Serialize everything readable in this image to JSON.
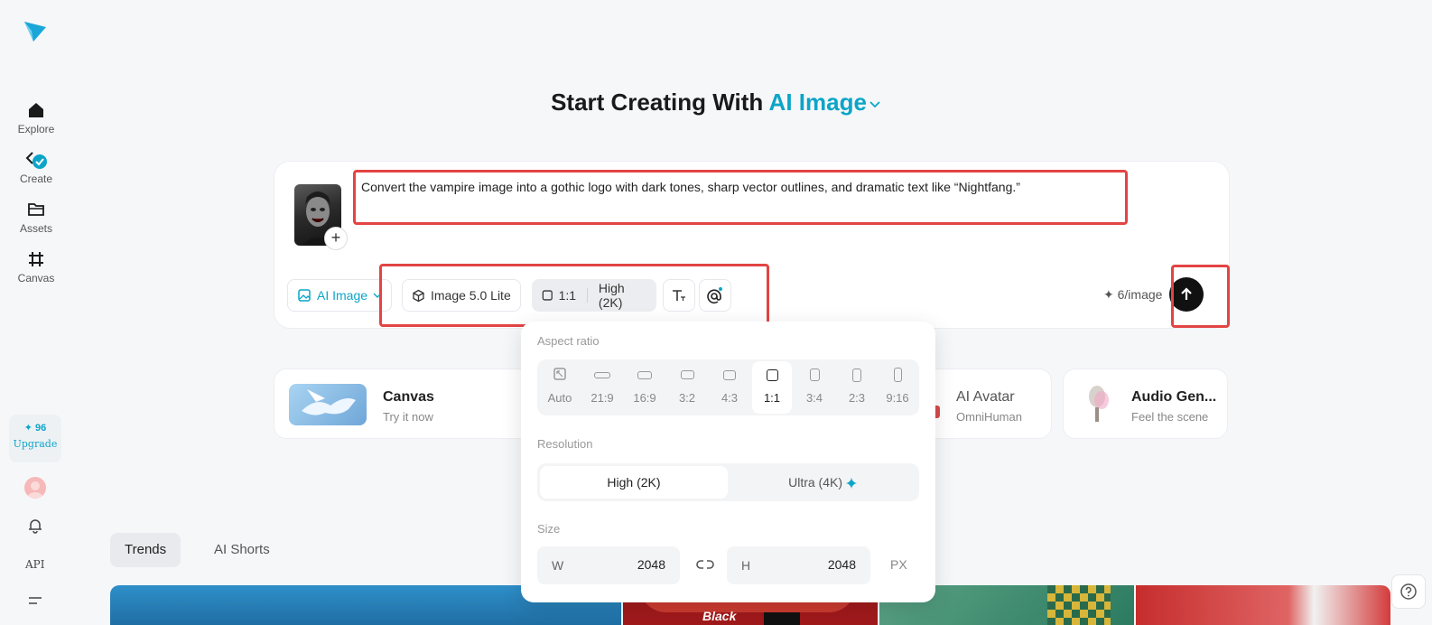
{
  "sidebar": {
    "items": [
      {
        "label": "Explore",
        "icon": "home-icon"
      },
      {
        "label": "Create",
        "icon": "create-icon"
      },
      {
        "label": "Assets",
        "icon": "folder-icon"
      },
      {
        "label": "Canvas",
        "icon": "canvas-icon"
      }
    ],
    "credits": "✦ 96",
    "upgrade_label": "Upgrade",
    "api_label": "API"
  },
  "headline": {
    "prefix": "Start Creating With",
    "mode": "AI Image"
  },
  "prompt": {
    "text": "Convert the vampire image into a gothic logo with dark tones, sharp vector outlines, and dramatic text like “Nightfang.”",
    "add_label": "+"
  },
  "toolbar": {
    "mode_label": "AI Image",
    "model_label": "Image 5.0 Lite",
    "ratio_label": "1:1",
    "quality_label": "High (2K)",
    "cost_label": "✦ 6/image"
  },
  "features": [
    {
      "title": "Canvas",
      "subtitle": "Try it now"
    },
    {
      "title": "AI Avatar",
      "subtitle": "OmniHuman"
    },
    {
      "title": "Audio Gen...",
      "subtitle": "Feel the scene"
    }
  ],
  "popup": {
    "aspect_label": "Aspect ratio",
    "ratios": [
      "Auto",
      "21:9",
      "16:9",
      "3:2",
      "4:3",
      "1:1",
      "3:4",
      "2:3",
      "9:16"
    ],
    "selected_ratio": "1:1",
    "resolution_label": "Resolution",
    "res_options": [
      "High (2K)",
      "Ultra (4K)"
    ],
    "selected_res": "High (2K)",
    "size_label": "Size",
    "w_label": "W",
    "w_value": "2048",
    "h_label": "H",
    "h_value": "2048",
    "unit": "PX"
  },
  "tabs": [
    "Trends",
    "AI Shorts"
  ],
  "gallery": {
    "card2_text": "Black"
  },
  "colors": {
    "accent": "#0ba5c8",
    "highlight": "#e34444"
  }
}
